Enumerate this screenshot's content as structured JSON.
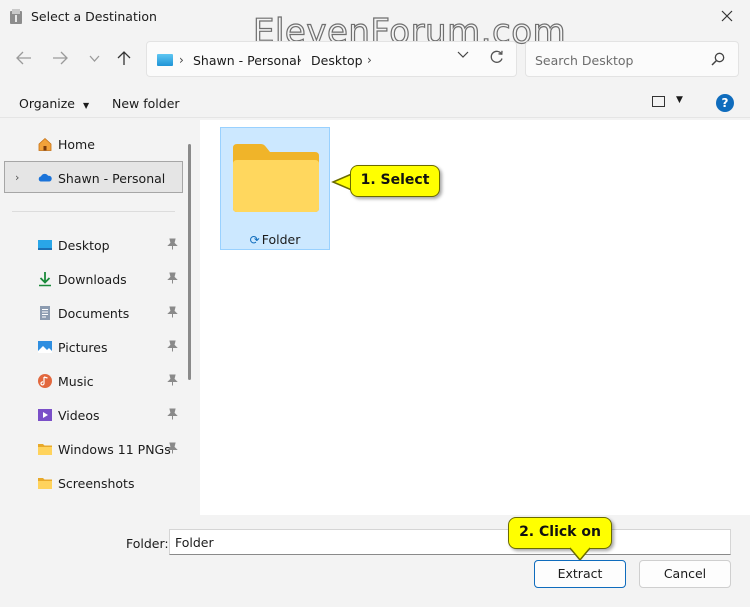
{
  "window": {
    "title": "Select a Destination",
    "watermark": "ElevenForum.com"
  },
  "address": {
    "crumbs": [
      "Shawn - Personal",
      "Desktop"
    ]
  },
  "search": {
    "placeholder": "Search Desktop"
  },
  "toolbar": {
    "organize_label": "Organize",
    "new_folder_label": "New folder",
    "help_label": "?"
  },
  "sidebar": {
    "items": [
      {
        "label": "Home",
        "icon": "home-icon"
      },
      {
        "label": "Shawn - Personal",
        "icon": "cloud-icon",
        "selected": true
      },
      {
        "label": "Desktop",
        "icon": "desktop-icon",
        "pinned": true
      },
      {
        "label": "Downloads",
        "icon": "download-icon",
        "pinned": true
      },
      {
        "label": "Documents",
        "icon": "documents-icon",
        "pinned": true
      },
      {
        "label": "Pictures",
        "icon": "pictures-icon",
        "pinned": true
      },
      {
        "label": "Music",
        "icon": "music-icon",
        "pinned": true
      },
      {
        "label": "Videos",
        "icon": "videos-icon",
        "pinned": true
      },
      {
        "label": "Windows 11 PNGs",
        "icon": "folder-icon",
        "pinned": true
      },
      {
        "label": "Screenshots",
        "icon": "folder-icon",
        "pinned": false
      }
    ]
  },
  "content": {
    "items": [
      {
        "label": "Folder",
        "selected": true
      }
    ]
  },
  "callouts": {
    "select": "1. Select",
    "click": "2. Click on"
  },
  "bottom": {
    "folder_label": "Folder:",
    "folder_value": "Folder",
    "extract_label": "Extract",
    "cancel_label": "Cancel"
  },
  "colors": {
    "accent": "#0f6cbd",
    "selection": "#cce8ff",
    "callout": "#ffff00"
  }
}
